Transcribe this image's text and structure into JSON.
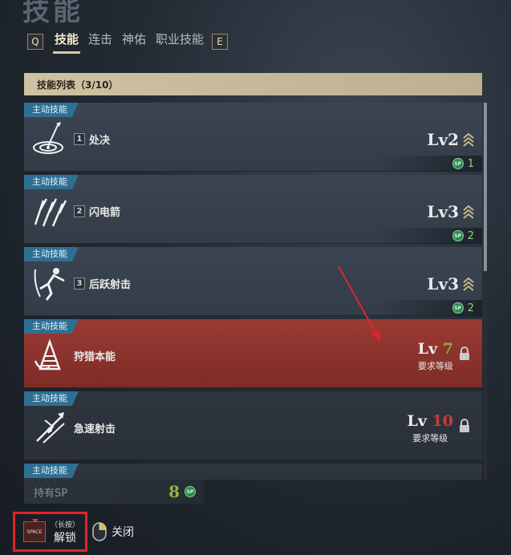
{
  "page": {
    "title": "技能"
  },
  "tabs": {
    "left_key": "Q",
    "right_key": "E",
    "items": [
      "技能",
      "连击",
      "神佑",
      "职业技能"
    ],
    "active_index": 0
  },
  "list": {
    "header": "技能列表（3/10）",
    "cards": [
      {
        "tag": "主动技能",
        "slot": "1",
        "name": "处决",
        "level": "Lv2",
        "sp": "1",
        "state": "learned",
        "icon": "target-arrow-icon"
      },
      {
        "tag": "主动技能",
        "slot": "2",
        "name": "闪电箭",
        "level": "Lv3",
        "sp": "2",
        "state": "learned",
        "icon": "lightning-arrows-icon"
      },
      {
        "tag": "主动技能",
        "slot": "3",
        "name": "后跃射击",
        "level": "Lv3",
        "sp": "2",
        "state": "learned",
        "icon": "leap-archer-icon"
      },
      {
        "tag": "主动技能",
        "name": "狩猎本能",
        "lock_prefix": "Lv ",
        "lock_level": "7",
        "lock_req": "要求等级",
        "state": "locked-highlight",
        "icon": "hunter-instinct-icon"
      },
      {
        "tag": "主动技能",
        "name": "急速射击",
        "lock_prefix": "Lv ",
        "lock_level": "10",
        "lock_req": "要求等级",
        "state": "locked",
        "icon": "rapid-shot-icon"
      },
      {
        "tag": "主动技能",
        "state": "partial"
      }
    ]
  },
  "sp_panel": {
    "label": "持有SP",
    "value": "8",
    "icon_text": "SP"
  },
  "footer": {
    "space_key": "SPACE",
    "hold_text": "（长按）",
    "unlock_label": "解锁",
    "close_label": "关闭"
  },
  "colors": {
    "tag_blue": "#2f6f93",
    "highlight_red": "#9b3a33",
    "sp_green": "#8ed18b",
    "unlock_border": "#e0242a",
    "annotation_arrow": "#e0242a"
  }
}
